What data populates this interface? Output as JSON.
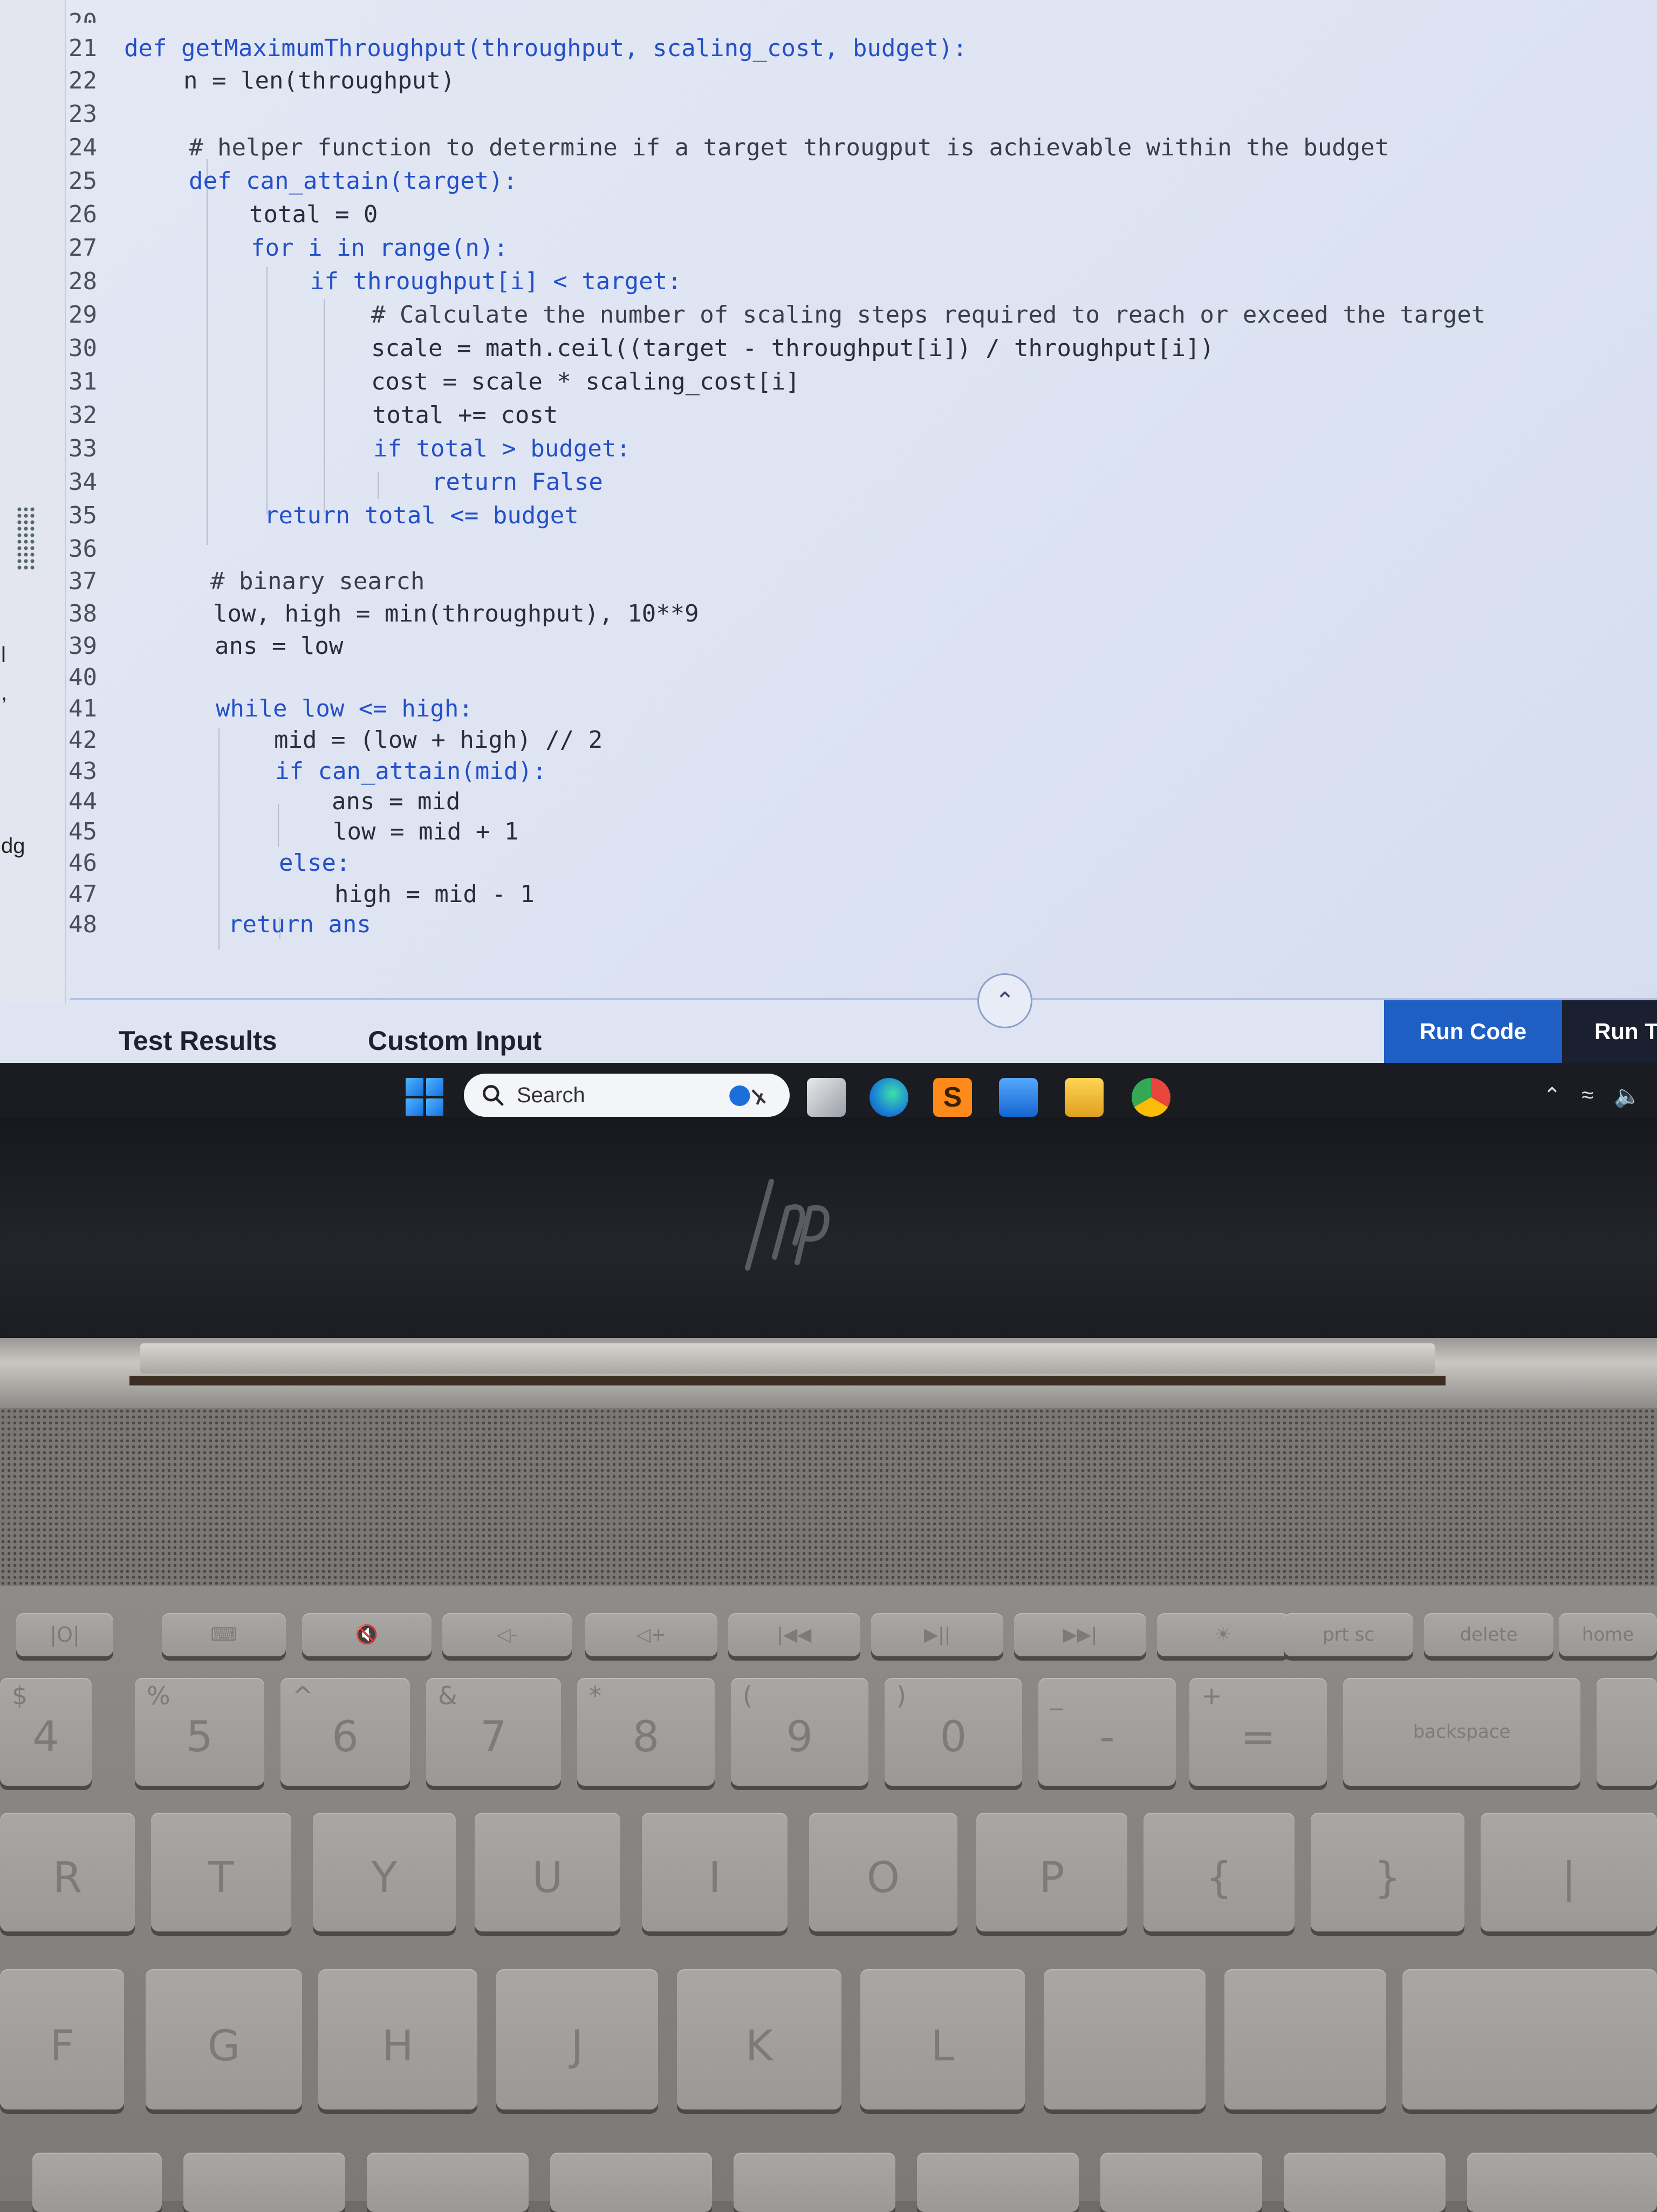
{
  "editor": {
    "partial_top_line": "20",
    "lines": [
      {
        "n": "21",
        "text": "def getMaximumThroughput(throughput, scaling_cost, budget):"
      },
      {
        "n": "22",
        "text": "n = len(throughput)"
      },
      {
        "n": "23",
        "text": ""
      },
      {
        "n": "24",
        "text": "# helper function to determine if a target througput is achievable within the budget"
      },
      {
        "n": "25",
        "text": "def can_attain(target):"
      },
      {
        "n": "26",
        "text": "total = 0"
      },
      {
        "n": "27",
        "text": "for i in range(n):"
      },
      {
        "n": "28",
        "text": "if throughput[i] < target:"
      },
      {
        "n": "29",
        "text": "# Calculate the number of scaling steps required to reach or exceed the target"
      },
      {
        "n": "30",
        "text": "scale = math.ceil((target - throughput[i]) / throughput[i])"
      },
      {
        "n": "31",
        "text": "cost = scale * scaling_cost[i]"
      },
      {
        "n": "32",
        "text": "total += cost"
      },
      {
        "n": "33",
        "text": "if total > budget:"
      },
      {
        "n": "34",
        "text": "return False"
      },
      {
        "n": "35",
        "text": "return total <= budget"
      },
      {
        "n": "36",
        "text": ""
      },
      {
        "n": "37",
        "text": "# binary search"
      },
      {
        "n": "38",
        "text": "low, high = min(throughput), 10**9"
      },
      {
        "n": "39",
        "text": "ans = low"
      },
      {
        "n": "40",
        "text": ""
      },
      {
        "n": "41",
        "text": "while low <= high:"
      },
      {
        "n": "42",
        "text": "mid = (low + high) // 2"
      },
      {
        "n": "43",
        "text": "if can_attain(mid):"
      },
      {
        "n": "44",
        "text": "ans = mid"
      },
      {
        "n": "45",
        "text": "low = mid + 1"
      },
      {
        "n": "46",
        "text": "else:"
      },
      {
        "n": "47",
        "text": "high = mid - 1"
      },
      {
        "n": "48",
        "text": "return ans"
      }
    ]
  },
  "left_partial": {
    "a": "l",
    "b": ",",
    "c": "dg"
  },
  "bottom_panel": {
    "tab_test_results": "Test Results",
    "tab_custom_input": "Custom Input",
    "run_code": "Run Code",
    "run_tests": "Run T",
    "expand_icon": "chevron-up"
  },
  "taskbar": {
    "search_label": "Search",
    "apps": [
      "windows-start",
      "task-view",
      "edge",
      "sublime-text",
      "mail",
      "file-explorer",
      "chrome"
    ],
    "tray": [
      "chevron-up",
      "wifi",
      "volume"
    ]
  },
  "keyboard": {
    "function_row": [
      "prt sc",
      "delete",
      "home"
    ],
    "number_row": [
      {
        "top": "$",
        "main": "4"
      },
      {
        "top": "%",
        "main": "5"
      },
      {
        "top": "^",
        "main": "6"
      },
      {
        "top": "&",
        "main": "7"
      },
      {
        "top": "*",
        "main": "8"
      },
      {
        "top": "(",
        "main": "9"
      },
      {
        "top": ")",
        "main": "0"
      },
      {
        "top": "_",
        "main": "-"
      },
      {
        "top": "+",
        "main": "="
      }
    ],
    "backspace": "backspace",
    "letter_row1": [
      "R",
      "T",
      "Y",
      "U",
      "I",
      "O",
      "P",
      "{",
      "}",
      "|"
    ],
    "letter_row2": [
      "F",
      "G",
      "H",
      "J",
      "K",
      "L"
    ]
  },
  "colors": {
    "screen_bg": "#dde3f2",
    "keyword": "#2450c8",
    "run_code_bg": "#1f5fc4",
    "run_tests_bg": "#1b2030",
    "taskbar_bg": "#1a1c22"
  }
}
